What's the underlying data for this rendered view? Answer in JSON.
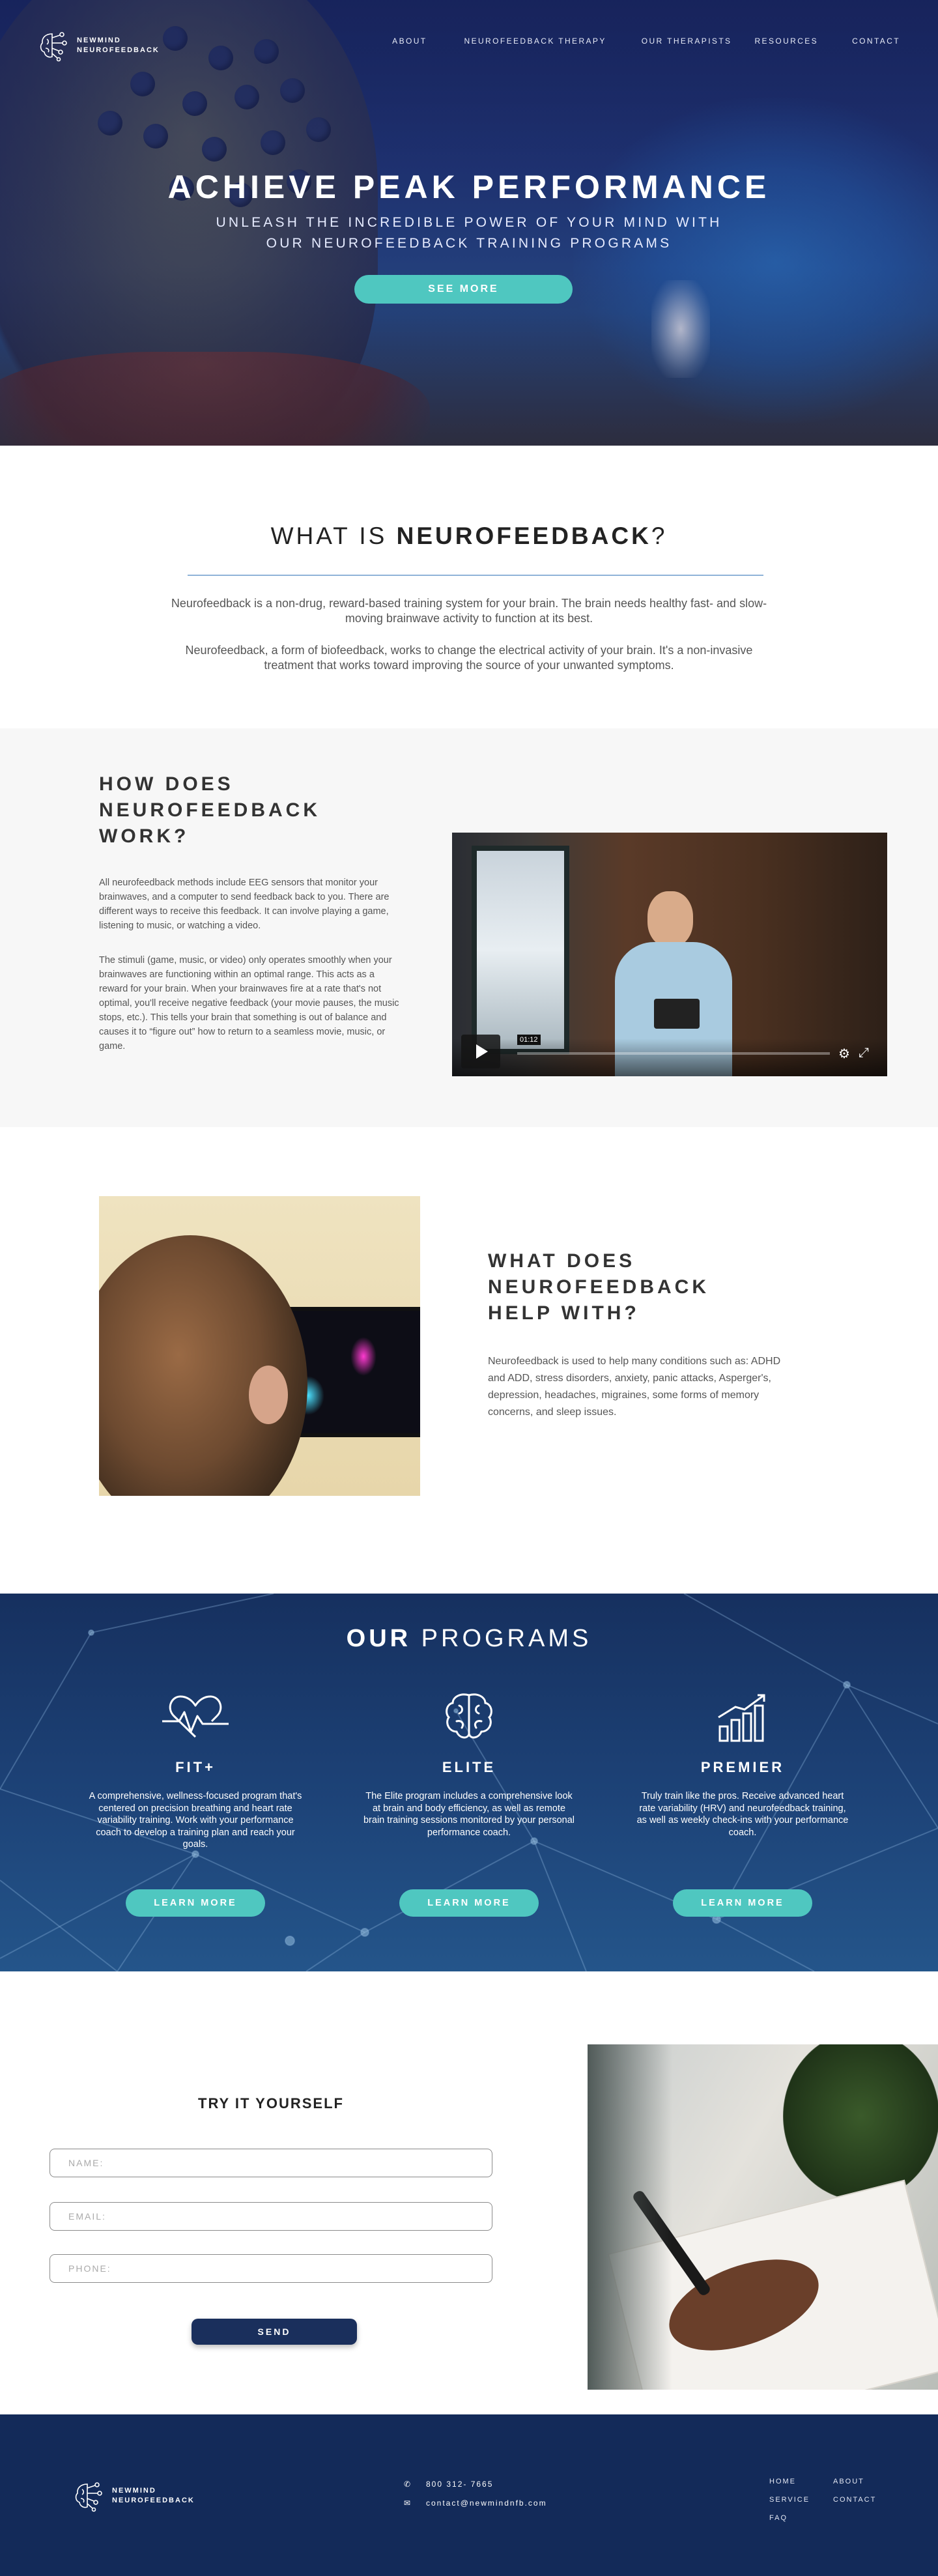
{
  "brand": {
    "name_line1": "NEWMIND",
    "name_line2": "NEUROFEEDBACK"
  },
  "nav": {
    "items": [
      {
        "label": "ABOUT"
      },
      {
        "label": "NEUROFEEDBACK THERAPY"
      },
      {
        "label": "OUR THERAPISTS"
      },
      {
        "label": "RESOURCES"
      },
      {
        "label": "CONTACT"
      }
    ]
  },
  "hero": {
    "title": "ACHIEVE PEAK PERFORMANCE",
    "subtitle": "UNLEASH THE INCREDIBLE POWER OF YOUR MIND WITH OUR NEUROFEEDBACK TRAINING PROGRAMS",
    "button_label": "SEE MORE"
  },
  "what_is": {
    "title_prefix": "WHAT IS ",
    "title_bold": "NEUROFEEDBACK",
    "title_suffix": "?",
    "p1": "Neurofeedback is a non-drug, reward-based training system for your brain. The brain needs healthy fast- and slow-moving brainwave activity to function at its best.",
    "p2": "Neurofeedback, a form of biofeedback, works to change the electrical activity of your brain. It's a non-invasive treatment that works toward improving the source of your unwanted symptoms."
  },
  "how": {
    "title": "HOW DOES NEUROFEEDBACK WORK?",
    "p1": "All neurofeedback methods include EEG sensors that monitor your brainwaves, and a computer to send feedback back to you. There are different ways to receive this feedback. It can involve playing a game, listening to music, or watching a video.",
    "p2": "The stimuli (game, music, or video) only operates smoothly when your brainwaves are functioning within an optimal range. This acts as a reward for your brain. When your brainwaves fire at a rate that's not optimal, you'll receive negative feedback (your movie pauses, the music stops, etc.). This tells your brain that something is out of balance and causes it to “figure out” how to return to a seamless movie, music, or game.",
    "video_time": "01:12"
  },
  "help": {
    "title": "WHAT DOES NEUROFEEDBACK HELP WITH?",
    "body": "Neurofeedback is used to help many conditions such as: ADHD and ADD, stress disorders, anxiety, panic attacks, Asperger's, depression, headaches, migraines, some forms of memory concerns, and sleep issues."
  },
  "programs": {
    "title_bold": "OUR",
    "title_rest": " PROGRAMS",
    "items": [
      {
        "name": "FIT+",
        "icon": "heartbeat-icon",
        "description": "A comprehensive, wellness-focused program that's centered on precision breathing and heart rate variability training. Work with your performance coach to develop a training plan and reach your goals.",
        "button": "LEARN MORE"
      },
      {
        "name": "ELITE",
        "icon": "brain-icon",
        "description": "The Elite program includes a comprehensive look at brain and body efficiency, as well as remote brain training sessions monitored by your personal performance coach.",
        "button": "LEARN MORE"
      },
      {
        "name": "PREMIER",
        "icon": "growth-chart-icon",
        "description": "Truly train like the pros. Receive advanced heart rate variability (HRV) and neurofeedback training, as well as weekly check-ins with your performance coach.",
        "button": "LEARN MORE"
      }
    ]
  },
  "try": {
    "title": "TRY IT YOURSELF",
    "name_placeholder": "NAME:",
    "email_placeholder": "EMAIL:",
    "phone_placeholder": "PHONE:",
    "button": "SEND"
  },
  "footer": {
    "phone": "800 312- 7665",
    "email": "contact@newmindnfb.com",
    "links_col1": [
      "HOME",
      "SERVICE",
      "FAQ"
    ],
    "links_col2": [
      "ABOUT",
      "CONTACT"
    ]
  },
  "colors": {
    "accent_teal": "#4fc7c0",
    "navy": "#132a59",
    "button_navy": "#1a2f5c"
  }
}
